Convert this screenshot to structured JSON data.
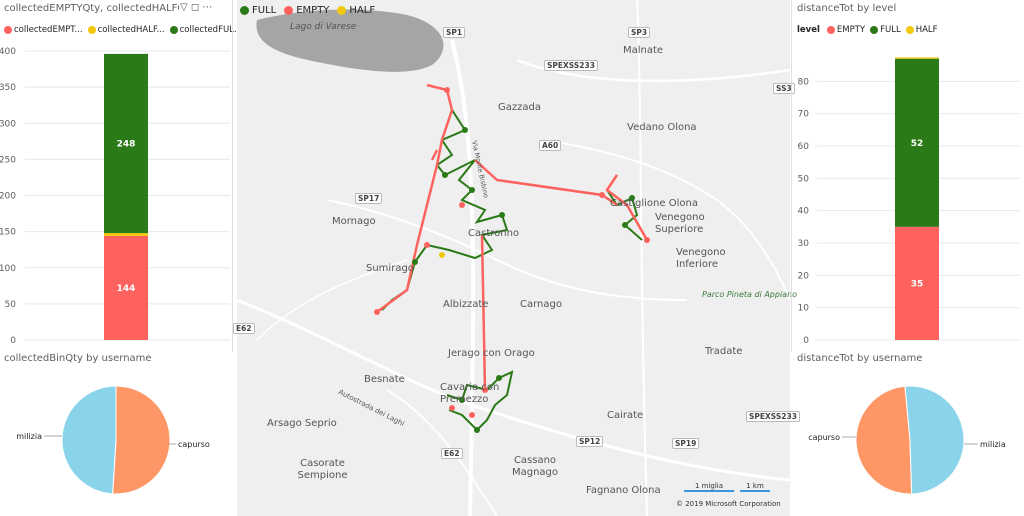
{
  "visuals": {
    "top_left": {
      "title": "collectedEMPTYQty, collectedHALFQty ar",
      "legend": [
        "collectedEMPT...",
        "collectedHALF...",
        "collectedFUL..."
      ],
      "icons": [
        "filter-icon",
        "focus-icon",
        "more-icon"
      ]
    },
    "bottom_left": {
      "title": "collectedBinQty by username"
    },
    "top_right": {
      "title": "distanceTot by level",
      "legend_title": "level",
      "legend": [
        "EMPTY",
        "FULL",
        "HALF"
      ]
    },
    "bottom_right": {
      "title": "distanceTot by username"
    },
    "map": {
      "legend": [
        "FULL",
        "EMPTY",
        "HALF"
      ],
      "towns": [
        "Lago di Varese",
        "Malnate",
        "Gazzada",
        "Vedano Olona",
        "Mornago",
        "Castiglione Olona",
        "Venegono Superiore",
        "Venegono Inferiore",
        "Castronno",
        "Sumirago",
        "Albizzate",
        "Carnago",
        "Parco Pineta di Appiano",
        "Jerago con Orago",
        "Tradate",
        "Besnate",
        "Cavaria con Premezzo",
        "Arsago Seprio",
        "Cairate",
        "Autostrada dei Laghi",
        "Casorate Sempione",
        "Cassano Magnago",
        "Fagnano Olona",
        "Via Monte Bisbino"
      ],
      "roads": [
        "SP1",
        "SP3",
        "SPEXSS233",
        "SS3",
        "A60",
        "SP17",
        "E62",
        "SP12",
        "SP19",
        "SPEXSS233",
        "E62"
      ],
      "scale": [
        "1 miglia",
        "1 km"
      ],
      "credit": "© 2019 Microsoft Corporation"
    }
  },
  "colors": {
    "empty": "#fd625e",
    "half": "#f2c80f",
    "full": "#2a7a17",
    "milizia": "#8ad4eb",
    "capurso": "#fe9666"
  },
  "chart_data": [
    {
      "type": "bar",
      "stacked": true,
      "categories": [
        ""
      ],
      "series": [
        {
          "name": "collectedEMPT...",
          "values": [
            144
          ]
        },
        {
          "name": "collectedHALF...",
          "values": [
            4
          ]
        },
        {
          "name": "collectedFUL...",
          "values": [
            248
          ]
        }
      ],
      "data_labels": [
        "144",
        "248"
      ],
      "ylim": [
        0,
        400
      ],
      "yticks": [
        "0",
        "50",
        "100",
        "150",
        "200",
        "250",
        "300",
        "350",
        "400"
      ],
      "grid": true,
      "legend_position": "top-left"
    },
    {
      "type": "bar",
      "stacked": true,
      "categories": [
        ""
      ],
      "series": [
        {
          "name": "EMPTY",
          "values": [
            35
          ]
        },
        {
          "name": "FULL",
          "values": [
            52
          ]
        },
        {
          "name": "HALF",
          "values": [
            0.4
          ]
        }
      ],
      "data_labels": [
        "35",
        "52"
      ],
      "ylim": [
        0,
        90
      ],
      "yticks": [
        "0",
        "10",
        "20",
        "30",
        "40",
        "50",
        "60",
        "70",
        "80"
      ],
      "grid": true,
      "legend_position": "top-left"
    },
    {
      "type": "pie",
      "labels": [
        "capurso",
        "milizia"
      ],
      "values": [
        51,
        49
      ],
      "legend_position": "none"
    },
    {
      "type": "pie",
      "labels": [
        "capurso",
        "milizia"
      ],
      "values": [
        49,
        51
      ],
      "legend_position": "none"
    }
  ]
}
